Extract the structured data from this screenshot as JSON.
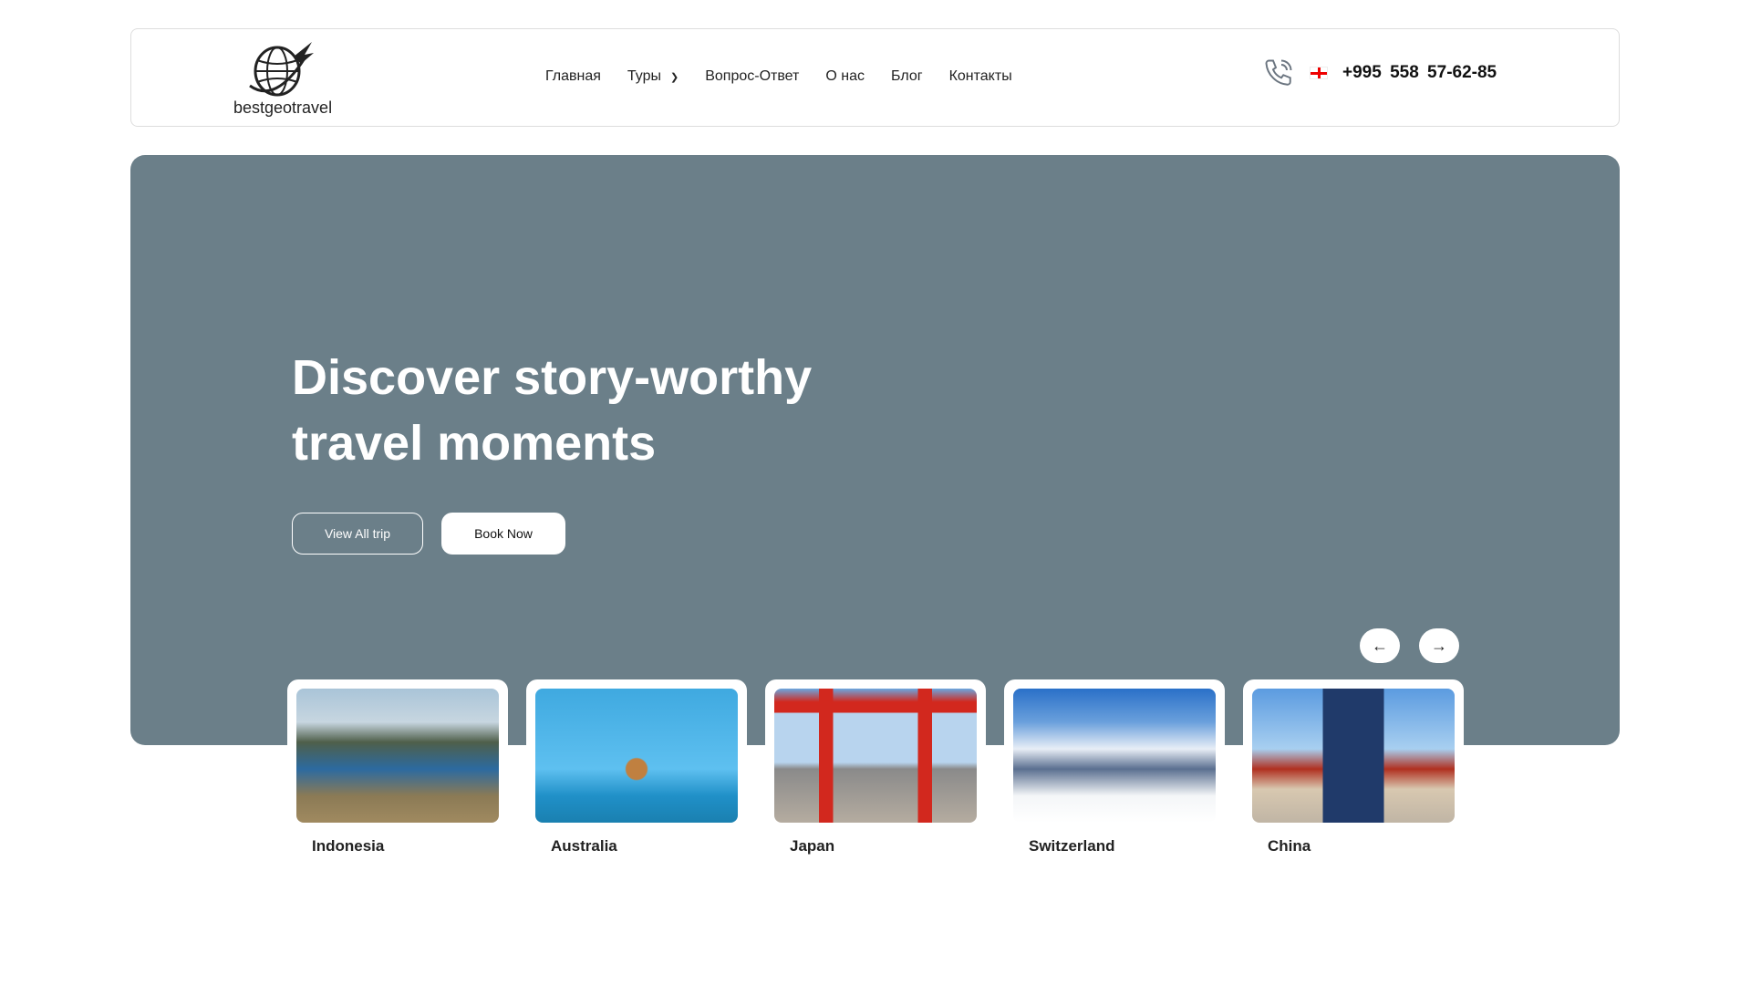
{
  "header": {
    "logo_text": "bestgeotravel",
    "nav": [
      "Главная",
      "Туры",
      "Вопрос-Ответ",
      "О нас",
      "Блог",
      "Контакты"
    ],
    "phone": "+995 558 57-62-85"
  },
  "hero": {
    "title": "Discover story-worthy travel moments",
    "view_all": "View All trip",
    "book_now": "Book Now",
    "bg_color": "#6b7f89"
  },
  "destinations": [
    {
      "name": "Indonesia"
    },
    {
      "name": "Australia"
    },
    {
      "name": "Japan"
    },
    {
      "name": "Switzerland"
    },
    {
      "name": "China"
    }
  ]
}
